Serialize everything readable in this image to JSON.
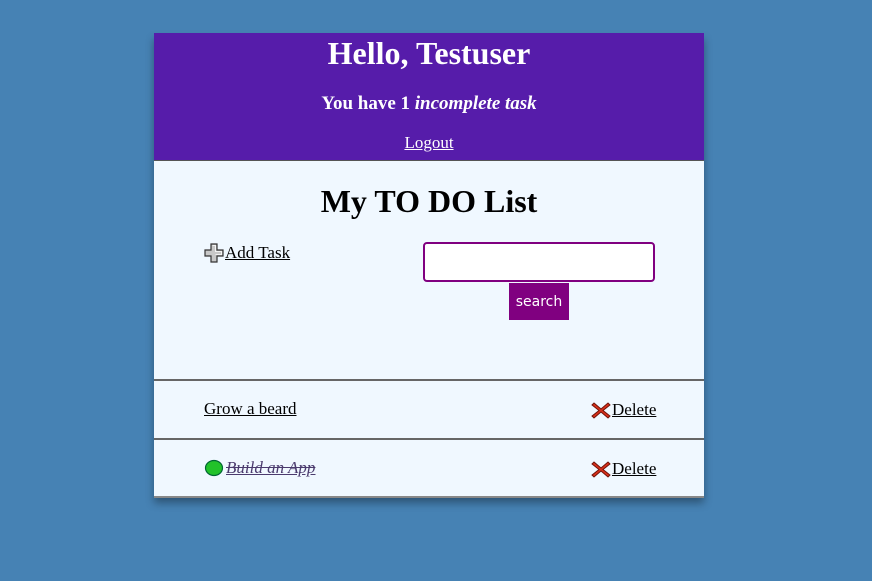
{
  "header": {
    "greeting": "Hello, Testuser",
    "task_count_prefix": "You have 1 ",
    "task_count_emphasis": "incomplete task",
    "logout_label": "Logout"
  },
  "main": {
    "title": "My TO DO List",
    "add_task_label": "Add Task",
    "search": {
      "value": "",
      "placeholder": "",
      "button_label": "search"
    }
  },
  "tasks": [
    {
      "label": "Grow a beard",
      "completed": false,
      "delete_label": "Delete"
    },
    {
      "label": "Build an App",
      "completed": true,
      "delete_label": "Delete"
    }
  ],
  "icons": {
    "add": "plus-icon",
    "delete": "x-icon",
    "completed": "green-circle-icon"
  },
  "colors": {
    "page_background": "#4682b4",
    "header_background": "#561caa",
    "card_background": "#f0f8ff",
    "accent": "#800080",
    "delete_icon": "#d9301a",
    "completed_icon": "#22c22a"
  }
}
